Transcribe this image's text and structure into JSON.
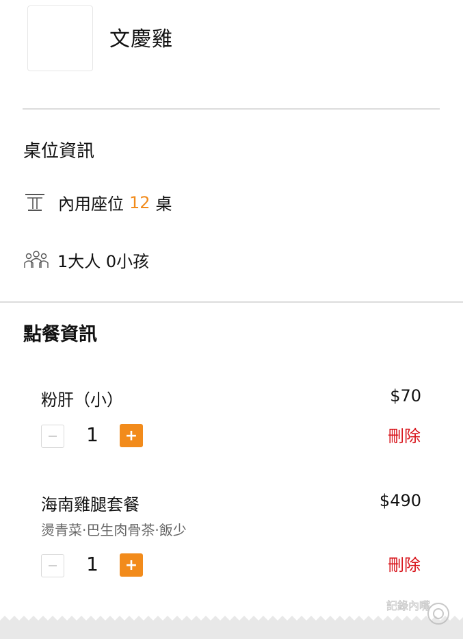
{
  "store": {
    "name": "文慶雞"
  },
  "table_info": {
    "title": "桌位資訊",
    "seat_prefix": "內用座位",
    "seat_number": "12",
    "seat_suffix": "桌",
    "people": "1大人 0小孩"
  },
  "order_info": {
    "title": "點餐資訊",
    "items": [
      {
        "name": "粉肝（小）",
        "price": "$70",
        "desc": "",
        "qty": "1",
        "delete_label": "刪除"
      },
      {
        "name": "海南雞腿套餐",
        "price": "$490",
        "desc": "燙青菜·巴生肉骨茶·飯少",
        "qty": "1",
        "delete_label": "刪除"
      }
    ]
  },
  "controls": {
    "minus": "−",
    "plus": "+"
  },
  "colors": {
    "accent": "#f28b1b",
    "delete": "#d8141b",
    "divider": "#dcdcdc"
  },
  "watermark": {
    "text": "記錄內嘴"
  }
}
